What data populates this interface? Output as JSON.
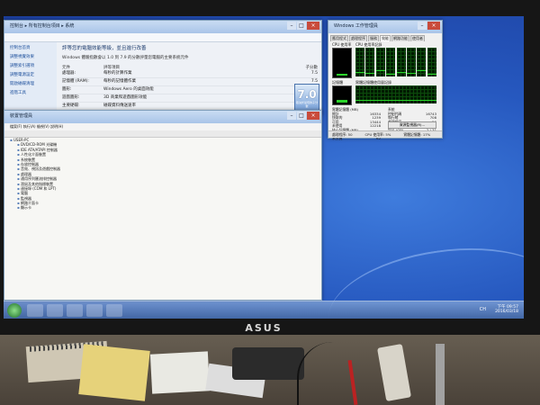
{
  "system_window": {
    "title": "控制台 ▸ 所有控制台項目 ▸ 系統",
    "heading": "評等您的電腦效能等級，並且進行改善",
    "subtitle": "Windows 體驗指數會以 1.0 到 7.9 的分數評量您電腦的主要系統元件",
    "left_links": [
      "控制台首頁",
      "調整視覺效果",
      "調整索引選項",
      "調整電源設定",
      "開啟磁碟清理",
      "進階工具"
    ],
    "columns": {
      "component": "元件",
      "rated": "評等項目",
      "subscore": "子分數",
      "base": "基本分數"
    },
    "rows": [
      {
        "k": "處理器:",
        "v": "每秒的計算作業",
        "s": "7.5"
      },
      {
        "k": "記憶體 (RAM):",
        "v": "每秒的記憶體作業",
        "s": "7.5"
      },
      {
        "k": "圖形:",
        "v": "Windows Aero 的桌面效能",
        "s": "7.5"
      },
      {
        "k": "遊戲圖形:",
        "v": "3D 商業和遊戲圖形效能",
        "s": "7.5"
      },
      {
        "k": "主要硬碟:",
        "v": "磁碟資料傳送速率",
        "s": "7.9"
      }
    ],
    "score": "7.0",
    "score_caption": "取決於最低的子分數"
  },
  "device_manager": {
    "title": "裝置管理員",
    "menu": "檔案(F)  執行(A)  檢視(V)  說明(H)",
    "root": "USER-PC",
    "items": [
      "DVD/CD-ROM 光碟機",
      "IDE ATA/ATAPI 控制器",
      "人性化介面裝置",
      "系統裝置",
      "存放控制器",
      "音效、視訊及遊戲控制器",
      "處理器",
      "通用序列匯流排控制器",
      "滑鼠及其他指標裝置",
      "連接埠 (COM 和 LPT)",
      "電腦",
      "監視器",
      "網路介面卡",
      "顯示卡"
    ]
  },
  "task_manager": {
    "title": "Windows 工作管理員",
    "tabs": [
      "應用程式",
      "處理程序",
      "服務",
      "效能",
      "網路功能",
      "使用者"
    ],
    "active_tab": "效能",
    "labels": {
      "cpu": "CPU 使用率",
      "cpu_hist": "CPU 使用率記錄",
      "mem": "記憶體",
      "mem_hist": "實體記憶體使用量記錄"
    },
    "cpu_percent": 5,
    "mem_percent": 17,
    "cpu_cores": [
      12,
      8,
      20,
      6,
      14,
      9,
      18,
      7
    ],
    "stats_left": [
      {
        "k": "實體記憶體 (MB)",
        "v": ""
      },
      {
        "k": "總計",
        "v": "16334"
      },
      {
        "k": "快取的",
        "v": "1239"
      },
      {
        "k": "可用",
        "v": "13444"
      },
      {
        "k": "未使用",
        "v": "12218"
      },
      {
        "k": "核心記憶體 (MB)",
        "v": ""
      },
      {
        "k": "分頁",
        "v": "255"
      },
      {
        "k": "未分頁",
        "v": "62"
      }
    ],
    "stats_right": [
      {
        "k": "系統",
        "v": ""
      },
      {
        "k": "控制代碼",
        "v": "16743"
      },
      {
        "k": "執行緒",
        "v": "708"
      },
      {
        "k": "處理程序",
        "v": "50"
      },
      {
        "k": "存留時間",
        "v": "0:00:11:26"
      },
      {
        "k": "認可 (GB)",
        "v": "2 / 31"
      }
    ],
    "resource_button": "資源監視器(R)...",
    "status": {
      "processes": "處理程序: 50",
      "cpu": "CPU 使用率: 5%",
      "mem": "實體記憶體: 17%"
    }
  },
  "taskbar": {
    "time": "下午 09:57",
    "date": "2016/03/18",
    "lang": "CH"
  },
  "monitor": {
    "brand": "ASUS"
  }
}
